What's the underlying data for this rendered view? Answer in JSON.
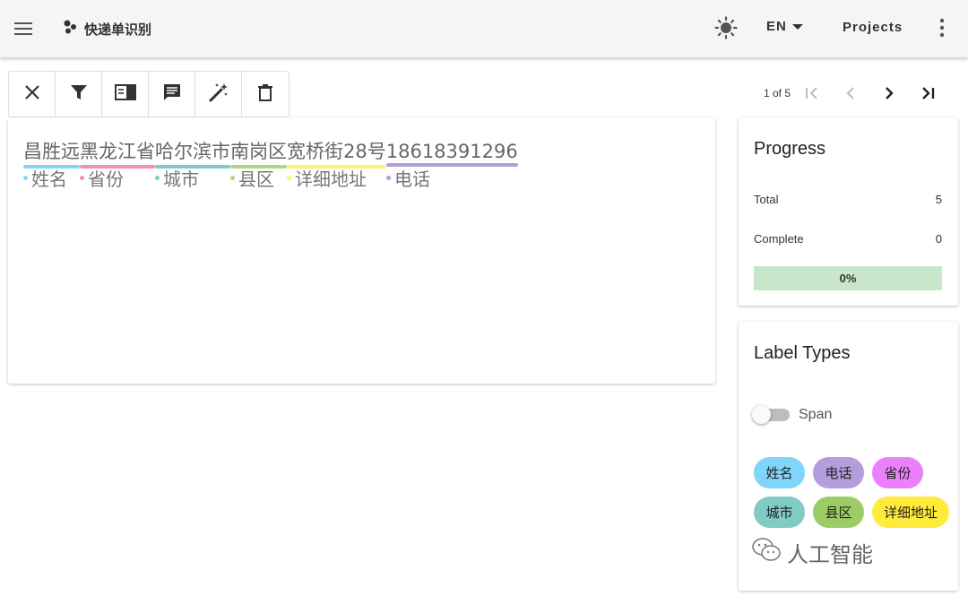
{
  "app": {
    "title": "快递单识别",
    "language": "EN",
    "projects_label": "Projects"
  },
  "icons": {
    "menu": "menu-icon",
    "logo": "bubbles-icon",
    "theme": "sun-icon",
    "lang_dropdown": "caret-down-icon",
    "more": "more-vertical-icon",
    "tools": [
      "close-icon",
      "filter-icon",
      "split-view-icon",
      "comment-icon",
      "magic-wand-icon",
      "trash-icon"
    ],
    "pager": [
      "first-page-icon",
      "prev-page-icon",
      "next-page-icon",
      "last-page-icon"
    ]
  },
  "pager": {
    "count": "1 of 5"
  },
  "document": {
    "segments": [
      {
        "text": "昌胜远",
        "color": "#81d4fa"
      },
      {
        "text": "黑龙江省",
        "color": "#f48fb1"
      },
      {
        "text": "哈尔滨市",
        "color": "#80cbc4"
      },
      {
        "text": "南岗区",
        "color": "#aed581"
      },
      {
        "text": "宽桥街28号",
        "color": "#fff176"
      },
      {
        "text": "18618391296",
        "color": "#b39ddb"
      }
    ],
    "entity_labels": [
      {
        "text": "姓名",
        "color": "#81d4fa"
      },
      {
        "text": "省份",
        "color": "#f48fb1"
      },
      {
        "text": "城市",
        "color": "#80cbc4"
      },
      {
        "text": "县区",
        "color": "#aed581"
      },
      {
        "text": "详细地址",
        "color": "#fff176"
      },
      {
        "text": "电话",
        "color": "#b39ddb"
      }
    ]
  },
  "progress": {
    "title": "Progress",
    "total_label": "Total",
    "total_value": "5",
    "complete_label": "Complete",
    "complete_value": "0",
    "percent_text": "0%",
    "percent": 0
  },
  "label_types": {
    "title": "Label Types",
    "toggle_label": "Span",
    "toggle_on": false,
    "chips": [
      {
        "text": "姓名",
        "color": "#81d4fa"
      },
      {
        "text": "电话",
        "color": "#b39ddb"
      },
      {
        "text": "省份",
        "color": "#ea80fc"
      },
      {
        "text": "城市",
        "color": "#80cbc4"
      },
      {
        "text": "县区",
        "color": "#9ccc65"
      },
      {
        "text": "详细地址",
        "color": "#ffeb3b"
      }
    ]
  },
  "watermark": {
    "text": "人工智能"
  }
}
